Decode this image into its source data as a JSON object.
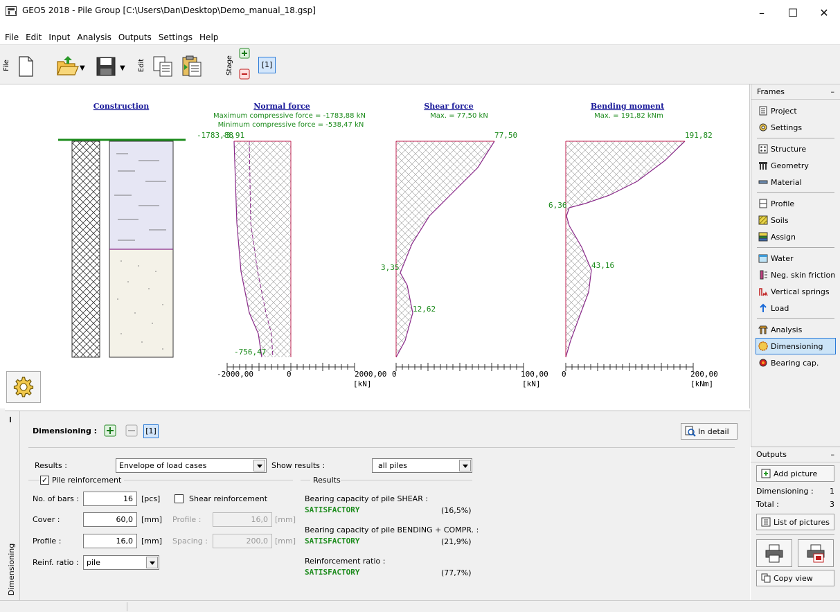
{
  "window": {
    "title": "GEO5 2018 - Pile Group [C:\\Users\\Dan\\Desktop\\Demo_manual_18.gsp]",
    "controls": {
      "minimize": "–",
      "maximize": "☐",
      "close": "✕"
    }
  },
  "menu": [
    "File",
    "Edit",
    "Input",
    "Analysis",
    "Outputs",
    "Settings",
    "Help"
  ],
  "toolbar": {
    "file_label": "File",
    "edit_label": "Edit",
    "stage_label": "Stage",
    "stage_value": "[1]"
  },
  "charts": {
    "construction_title": "Construction",
    "normal": {
      "title": "Normal force",
      "max_text": "Maximum compressive force = -1783,88 kN",
      "min_text": "Minimum compressive force = -538,47 kN",
      "top_labels": "-1783,88",
      "top_label2": "-3,91",
      "bottom_label": "-756,47",
      "axis_left": "2000,00",
      "axis_zero": "0",
      "axis_right": "2000,00",
      "unit": "[kN]"
    },
    "shear": {
      "title": "Shear force",
      "max_text": "Max. = 77,50 kN",
      "labels": [
        "77,50",
        "3,35",
        "12,62"
      ],
      "axis_zero": "0",
      "axis_right": "100,00",
      "unit": "[kN]"
    },
    "moment": {
      "title": "Bending moment",
      "max_text": "Max. = 191,82 kNm",
      "labels": [
        "191,82",
        "6,36",
        "43,16"
      ],
      "axis_zero": "0",
      "axis_right": "200,00",
      "unit": "[kNm]"
    }
  },
  "frames": {
    "header": "Frames",
    "collapse": "–",
    "items": [
      {
        "label": "Project",
        "icon": "project-icon"
      },
      {
        "label": "Settings",
        "icon": "settings-icon"
      },
      {
        "label": "Structure",
        "icon": "structure-icon"
      },
      {
        "label": "Geometry",
        "icon": "geometry-icon"
      },
      {
        "label": "Material",
        "icon": "material-icon"
      },
      {
        "label": "Profile",
        "icon": "profile-icon"
      },
      {
        "label": "Soils",
        "icon": "soils-icon"
      },
      {
        "label": "Assign",
        "icon": "assign-icon"
      },
      {
        "label": "Water",
        "icon": "water-icon"
      },
      {
        "label": "Neg. skin friction",
        "icon": "neg-skin-friction-icon"
      },
      {
        "label": "Vertical springs",
        "icon": "vertical-springs-icon"
      },
      {
        "label": "Load",
        "icon": "load-icon"
      },
      {
        "label": "Analysis",
        "icon": "analysis-icon"
      },
      {
        "label": "Dimensioning",
        "icon": "dimensioning-icon"
      },
      {
        "label": "Bearing cap.",
        "icon": "bearing-cap-icon"
      }
    ]
  },
  "outputs": {
    "header": "Outputs",
    "collapse": "–",
    "add_picture": "Add picture",
    "dimensioning_label": "Dimensioning :",
    "dimensioning_count": "1",
    "total_label": "Total :",
    "total_count": "3",
    "list_pictures": "List of pictures",
    "copy_view": "Copy view"
  },
  "bottom": {
    "vtab": "Dimensioning",
    "header": "Dimensioning :",
    "stage": "[1]",
    "in_detail": "In detail",
    "results_label": "Results :",
    "results_value": "Envelope of load cases",
    "show_results_label": "Show results :",
    "show_results_value": "all piles",
    "pile_reinf_label": "Pile reinforcement",
    "no_bars_label": "No. of bars :",
    "no_bars_value": "16",
    "no_bars_unit": "[pcs]",
    "cover_label": "Cover :",
    "cover_value": "60,0",
    "cover_unit": "[mm]",
    "profile_label": "Profile :",
    "profile_value": "16,0",
    "profile_unit": "[mm]",
    "reinf_ratio_label": "Reinf. ratio :",
    "reinf_ratio_value": "pile",
    "shear_reinf_label": "Shear reinforcement",
    "shear_profile_label": "Profile :",
    "shear_profile_value": "16,0",
    "shear_profile_unit": "[mm]",
    "spacing_label": "Spacing :",
    "spacing_value": "200,0",
    "spacing_unit": "[mm]",
    "results_group": "Results",
    "r1_label": "Bearing capacity of pile SHEAR :",
    "r1_status": "SATISFACTORY",
    "r1_value": "(16,5%)",
    "r2_label": "Bearing capacity of pile BENDING + COMPR. :",
    "r2_status": "SATISFACTORY",
    "r2_value": "(21,9%)",
    "r3_label": "Reinforcement ratio :",
    "r3_status": "SATISFACTORY",
    "r3_value": "(77,7%)"
  },
  "colors": {
    "accent": "#2a7bd8",
    "satisfactory": "#1e8c1e",
    "diagram_line": "#c0368a",
    "label_green": "#1a8a1a",
    "title_blue": "#1a1a9a"
  }
}
